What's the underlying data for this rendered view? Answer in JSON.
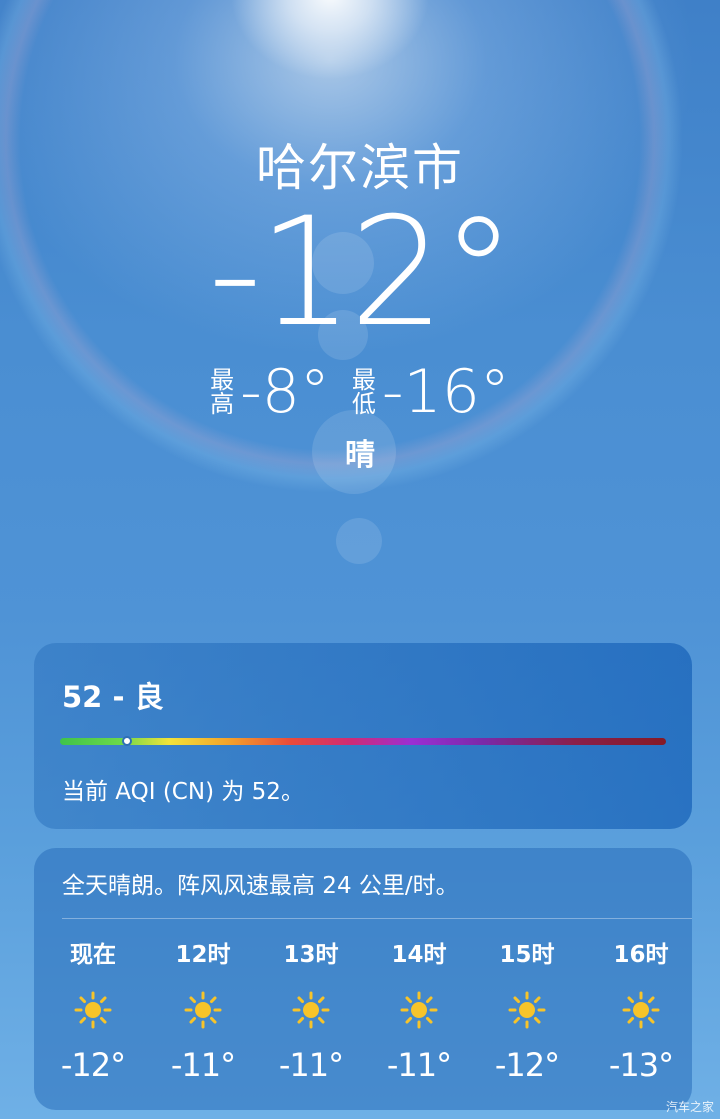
{
  "header": {
    "city": "哈尔滨市",
    "current_temp": "-12°",
    "high_label": "最高",
    "high_value": "-8°",
    "low_label": "最低",
    "low_value": "-16°",
    "condition": "晴"
  },
  "aqi": {
    "headline": "52 - 良",
    "description": "当前 AQI (CN) 为 52。",
    "value": 52,
    "marker_fraction": 0.11
  },
  "forecast": {
    "summary": "全天晴朗。阵风风速最高 24 公里/时。",
    "hours": [
      {
        "label": "现在",
        "icon": "sun-icon",
        "temp": "-12°"
      },
      {
        "label": "12时",
        "icon": "sun-icon",
        "temp": "-11°"
      },
      {
        "label": "13时",
        "icon": "sun-icon",
        "temp": "-11°"
      },
      {
        "label": "14时",
        "icon": "sun-icon",
        "temp": "-11°"
      },
      {
        "label": "15时",
        "icon": "sun-icon",
        "temp": "-12°"
      },
      {
        "label": "16时",
        "icon": "sun-icon",
        "temp": "-13°"
      }
    ]
  },
  "colors": {
    "sun": "#f7c42a",
    "sky_top": "#3f80c8",
    "sky_bottom": "#6fb0e6"
  },
  "watermark": "汽车之家"
}
